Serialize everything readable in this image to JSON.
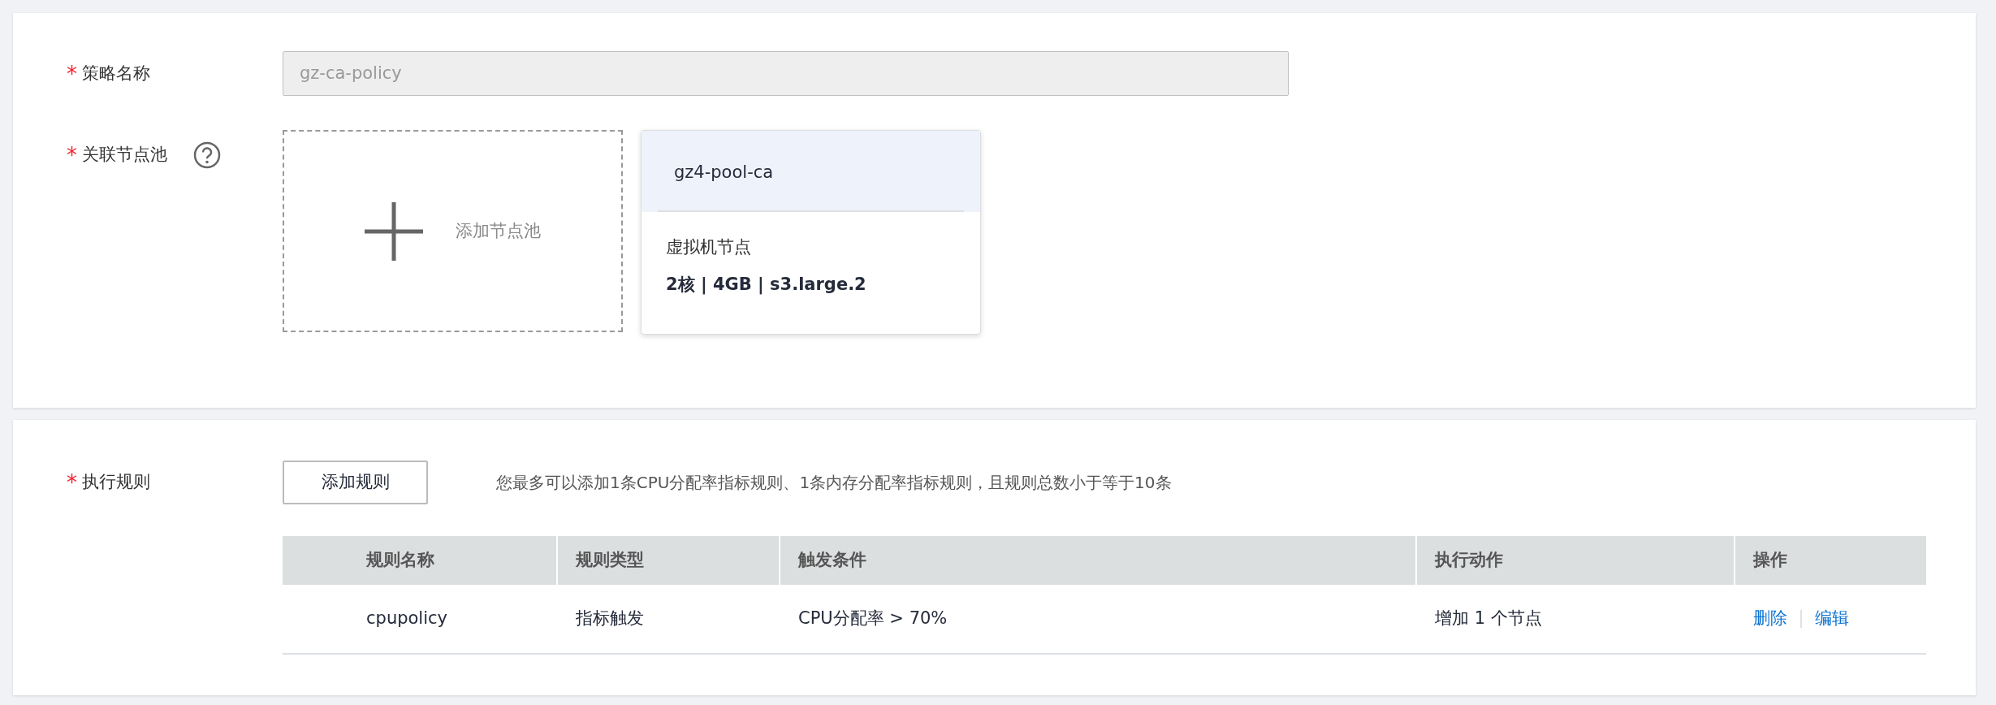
{
  "policy_name": {
    "required_mark": "*",
    "label": "策略名称",
    "value": "gz-ca-policy",
    "disabled": true
  },
  "node_pools": {
    "required_mark": "*",
    "label": "关联节点池",
    "add_label": "添加节点池",
    "pools": [
      {
        "name": "gz4-pool-ca",
        "type": "虚拟机节点",
        "specs": "2核 | 4GB | s3.large.2"
      }
    ]
  },
  "rules": {
    "required_mark": "*",
    "label": "执行规则",
    "add_button": "添加规则",
    "hint": "您最多可以添加1条CPU分配率指标规则、1条内存分配率指标规则，且规则总数小于等于10条",
    "table": {
      "columns": [
        "规则名称",
        "规则类型",
        "触发条件",
        "执行动作",
        "操作"
      ],
      "rows": [
        {
          "cells": [
            "cpupolicy",
            "指标触发",
            "CPU分配率 > 70%",
            "增加 1 个节点"
          ],
          "actions": [
            "删除",
            "编辑"
          ]
        }
      ]
    }
  }
}
